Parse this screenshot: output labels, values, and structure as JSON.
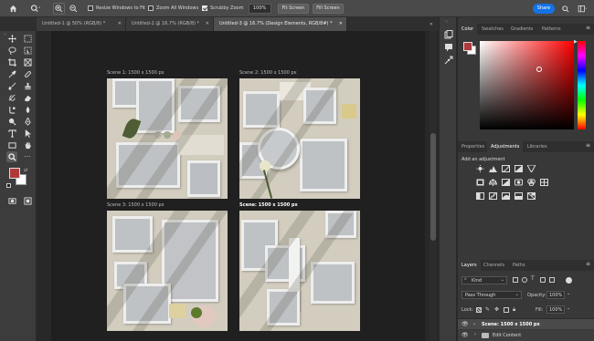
{
  "options_bar": {
    "resize_windows_label": "Resize Windows to Fit",
    "zoom_all_label": "Zoom All Windows",
    "scrubby_zoom_label": "Scrubby Zoom",
    "zoom_value": "100%",
    "fit_screen_label": "Fit Screen",
    "fill_screen_label": "Fill Screen",
    "share_label": "Share",
    "resize_windows_checked": false,
    "zoom_all_checked": false,
    "scrubby_zoom_checked": true
  },
  "tabs": [
    {
      "label": "Untitled-1 @ 50% (RGB/8) *",
      "active": false
    },
    {
      "label": "Untitled-2 @ 16.7% (RGB/8) *",
      "active": false
    },
    {
      "label": "Untitled-3 @ 16.7% (Design Elements, RGB/8#) *",
      "active": true
    }
  ],
  "artboards": [
    {
      "label": "Scene 1: 1500 x 1500 px",
      "selected": false
    },
    {
      "label": "Scene 2: 1500 x 1500 px",
      "selected": false
    },
    {
      "label": "Scene 3: 1500 x 1500 px",
      "selected": false
    },
    {
      "label": "Scene: 1500 x 1500 px",
      "selected": true
    }
  ],
  "color_panel": {
    "tabs": [
      "Color",
      "Swatches",
      "Gradients",
      "Patterns"
    ],
    "active_tab": "Color",
    "foreground": "#b03a3a",
    "background": "#ffffff",
    "hue_base": "#ff0000"
  },
  "adjustments_panel": {
    "tabs": [
      "Properties",
      "Adjustments",
      "Libraries"
    ],
    "active_tab": "Adjustments",
    "add_label": "Add an adjustment"
  },
  "layers_panel": {
    "tabs": [
      "Layers",
      "Channels",
      "Paths"
    ],
    "active_tab": "Layers",
    "filter_kind": "Kind",
    "blend_mode": "Pass Through",
    "opacity_label": "Opacity:",
    "opacity_value": "100%",
    "lock_label": "Lock:",
    "fill_label": "Fill:",
    "fill_value": "100%",
    "layers": [
      {
        "name": "Scene: 1500 x 1500 px",
        "type": "artboard"
      },
      {
        "name": "Edit Content",
        "type": "group"
      }
    ]
  }
}
